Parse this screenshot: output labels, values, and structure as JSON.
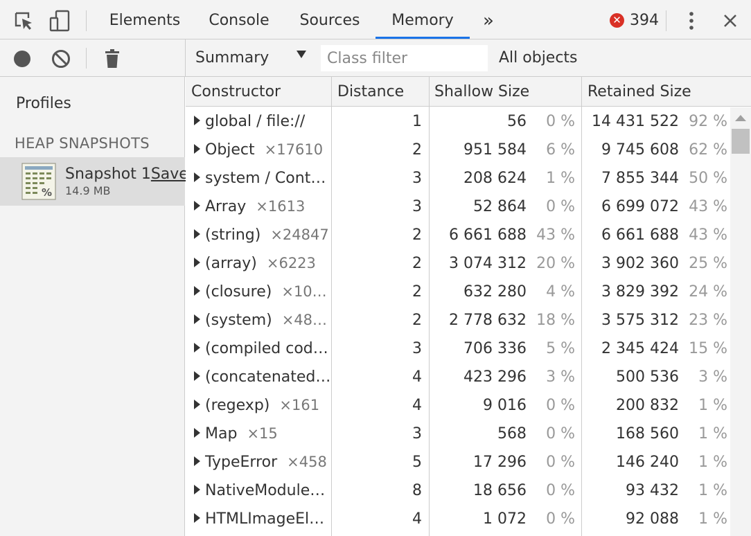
{
  "tabs": [
    "Elements",
    "Console",
    "Sources",
    "Memory"
  ],
  "active_tab": "Memory",
  "more_tabs_label": "»",
  "error_icon_glyph": "✕",
  "error_count": "394",
  "close_label": "✕",
  "toolbar": {
    "view_select": "Summary",
    "class_filter_placeholder": "Class filter",
    "filter_scope": "All objects"
  },
  "sidebar": {
    "profiles_label": "Profiles",
    "section_label": "HEAP SNAPSHOTS",
    "snapshot": {
      "name": "Snapshot 1",
      "save_label": "Save",
      "size": "14.9 MB"
    }
  },
  "table": {
    "headers": [
      "Constructor",
      "Distance",
      "Shallow Size",
      "Retained Size"
    ],
    "rows": [
      {
        "name": "global / file://",
        "count": "",
        "distance": "1",
        "shallow": "56",
        "shallow_pct": "0 %",
        "retained": "14 431 522",
        "retained_pct": "92 %"
      },
      {
        "name": "Object",
        "count": "×17610",
        "distance": "2",
        "shallow": "951 584",
        "shallow_pct": "6 %",
        "retained": "9 745 608",
        "retained_pct": "62 %"
      },
      {
        "name": "system / Cont…",
        "count": "",
        "distance": "3",
        "shallow": "208 624",
        "shallow_pct": "1 %",
        "retained": "7 855 344",
        "retained_pct": "50 %"
      },
      {
        "name": "Array",
        "count": "×1613",
        "distance": "3",
        "shallow": "52 864",
        "shallow_pct": "0 %",
        "retained": "6 699 072",
        "retained_pct": "43 %"
      },
      {
        "name": "(string)",
        "count": "×24847",
        "distance": "2",
        "shallow": "6 661 688",
        "shallow_pct": "43 %",
        "retained": "6 661 688",
        "retained_pct": "43 %"
      },
      {
        "name": "(array)",
        "count": "×6223",
        "distance": "2",
        "shallow": "3 074 312",
        "shallow_pct": "20 %",
        "retained": "3 902 360",
        "retained_pct": "25 %"
      },
      {
        "name": "(closure)",
        "count": "×10…",
        "distance": "2",
        "shallow": "632 280",
        "shallow_pct": "4 %",
        "retained": "3 829 392",
        "retained_pct": "24 %"
      },
      {
        "name": "(system)",
        "count": "×48…",
        "distance": "2",
        "shallow": "2 778 632",
        "shallow_pct": "18 %",
        "retained": "3 575 312",
        "retained_pct": "23 %"
      },
      {
        "name": "(compiled cod…",
        "count": "",
        "distance": "3",
        "shallow": "706 336",
        "shallow_pct": "5 %",
        "retained": "2 345 424",
        "retained_pct": "15 %"
      },
      {
        "name": "(concatenated…",
        "count": "",
        "distance": "4",
        "shallow": "423 296",
        "shallow_pct": "3 %",
        "retained": "500 536",
        "retained_pct": "3 %"
      },
      {
        "name": "(regexp)",
        "count": "×161",
        "distance": "4",
        "shallow": "9 016",
        "shallow_pct": "0 %",
        "retained": "200 832",
        "retained_pct": "1 %"
      },
      {
        "name": "Map",
        "count": "×15",
        "distance": "3",
        "shallow": "568",
        "shallow_pct": "0 %",
        "retained": "168 560",
        "retained_pct": "1 %"
      },
      {
        "name": "TypeError",
        "count": "×458",
        "distance": "5",
        "shallow": "17 296",
        "shallow_pct": "0 %",
        "retained": "146 240",
        "retained_pct": "1 %"
      },
      {
        "name": "NativeModule…",
        "count": "",
        "distance": "8",
        "shallow": "18 656",
        "shallow_pct": "0 %",
        "retained": "93 432",
        "retained_pct": "1 %"
      },
      {
        "name": "HTMLImageEl…",
        "count": "",
        "distance": "4",
        "shallow": "1 072",
        "shallow_pct": "0 %",
        "retained": "92 088",
        "retained_pct": "1 %"
      }
    ]
  },
  "colors": {
    "accent": "#1a73e8",
    "error": "#d93025",
    "panel_bg": "#f3f3f3",
    "selected_bg": "#dddddd"
  }
}
